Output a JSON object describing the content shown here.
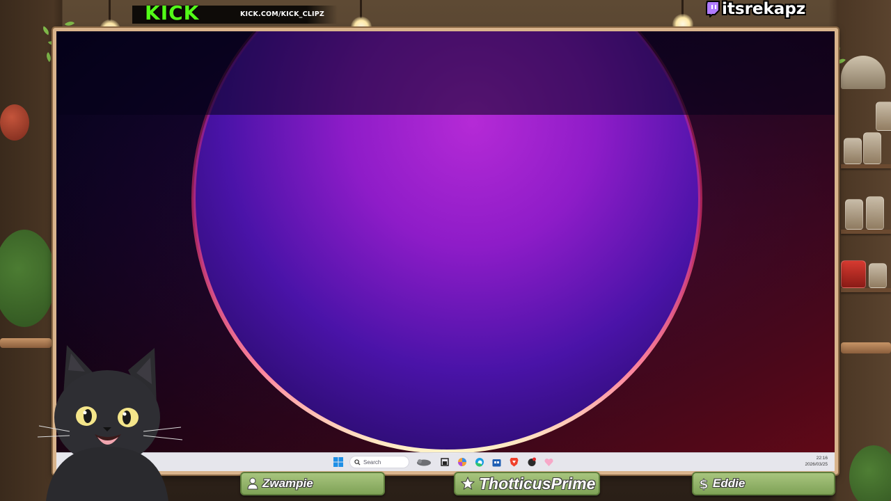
{
  "overlay": {
    "kick_logo": "KICK",
    "kick_url": "KICK.COM/KICK_CLIPZ",
    "twitch_handle": "itsrekapz",
    "twitch_icon": "twitch-icon"
  },
  "desktop": {
    "wallpaper": "purple-orb-gradient",
    "taskbar": {
      "search_placeholder": "Search",
      "clock_time": "22:16",
      "clock_date": "2026/03/25",
      "icons": [
        "windows-start-icon",
        "search-icon",
        "widget-icon",
        "task-view-icon",
        "copilot-icon",
        "edge-icon",
        "store-icon",
        "brave-icon",
        "app-icon",
        "pink-app-icon"
      ]
    }
  },
  "name_plates": {
    "left": {
      "label": "Zwampie",
      "icon": "person-icon"
    },
    "center": {
      "label": "ThotticusPrime",
      "icon": "star-icon"
    },
    "right": {
      "label": "Eddie",
      "icon": "dollar-icon"
    }
  },
  "colors": {
    "kick_green": "#53fc18",
    "frame": "#d9b48c",
    "plate_green": "#8fb266"
  }
}
